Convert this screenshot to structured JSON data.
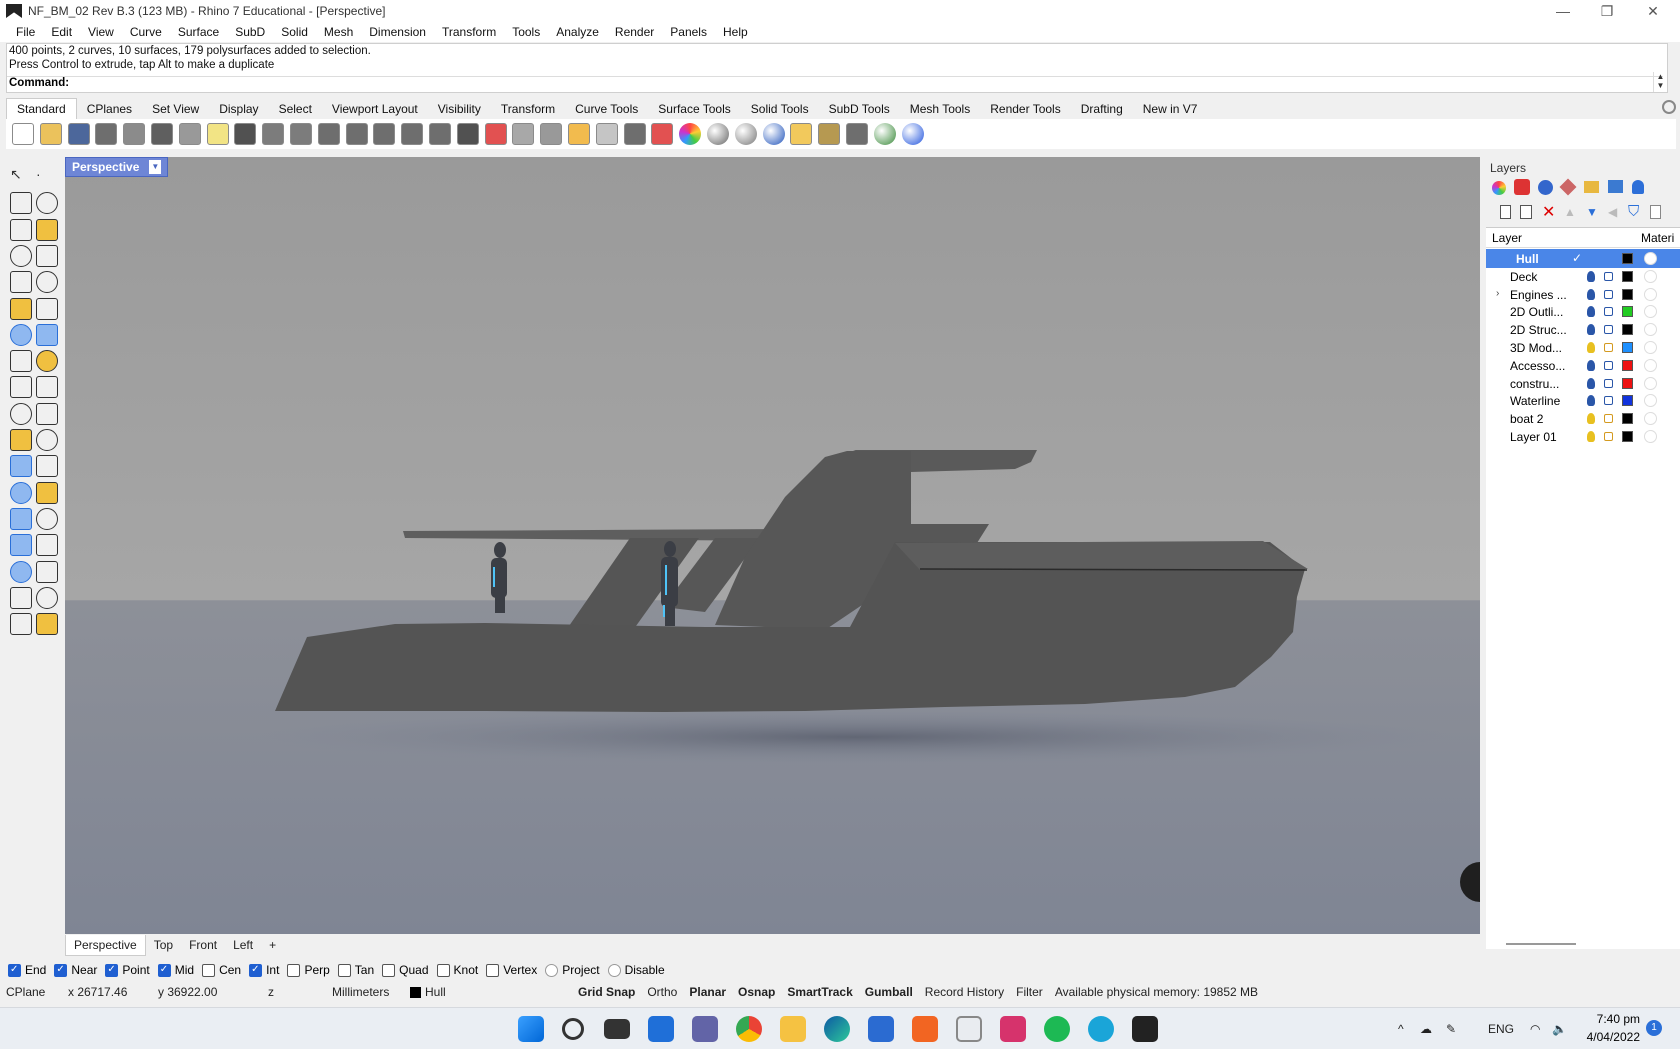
{
  "window": {
    "title": "NF_BM_02 Rev B.3 (123 MB) - Rhino 7 Educational - [Perspective]",
    "controls": [
      "—",
      "❐",
      "✕"
    ]
  },
  "menu": [
    "File",
    "Edit",
    "View",
    "Curve",
    "Surface",
    "SubD",
    "Solid",
    "Mesh",
    "Dimension",
    "Transform",
    "Tools",
    "Analyze",
    "Render",
    "Panels",
    "Help"
  ],
  "command": {
    "history": [
      "400 points, 2 curves, 10 surfaces, 179 polysurfaces added to selection.",
      "Press Control to extrude, tap Alt to make a duplicate"
    ],
    "prompt": "Command:"
  },
  "toolbar_tabs": [
    "Standard",
    "CPlanes",
    "Set View",
    "Display",
    "Select",
    "Viewport Layout",
    "Visibility",
    "Transform",
    "Curve Tools",
    "Surface Tools",
    "Solid Tools",
    "SubD Tools",
    "Mesh Tools",
    "Render Tools",
    "Drafting",
    "New in V7"
  ],
  "toolbar_icons": [
    "new-file-icon",
    "open-folder-icon",
    "save-icon",
    "print-icon",
    "export-icon",
    "cut-icon",
    "copy-icon",
    "paste-icon",
    "undo-icon",
    "pan-hand-icon",
    "rotate-view-icon",
    "zoom-icon",
    "zoom-window-icon",
    "zoom-extents-icon",
    "zoom-selected-icon",
    "rotate-icon",
    "four-views-icon",
    "car-icon",
    "motor-icon",
    "cplane-icon",
    "points-icon",
    "light-icon",
    "lock-icon",
    "layer-icon",
    "color-wheel-icon",
    "sphere-icon",
    "render-sphere-icon",
    "blue-sphere-icon",
    "filter-icon",
    "gear-icon",
    "dimension-icon",
    "globe-icon",
    "help-icon"
  ],
  "viewport": {
    "active": "Perspective",
    "tabs": [
      "Perspective",
      "Top",
      "Front",
      "Left"
    ],
    "add_tab": "+"
  },
  "layers_panel": {
    "title": "Layers",
    "col_layer": "Layer",
    "col_material": "Materi",
    "layers": [
      {
        "name": "Hull",
        "color": "#000000",
        "current": true,
        "selected": true
      },
      {
        "name": "Deck",
        "color": "#000000"
      },
      {
        "name": "Engines ...",
        "color": "#000000",
        "expandable": true
      },
      {
        "name": "2D Outli...",
        "color": "#22cc22"
      },
      {
        "name": "2D Struc...",
        "color": "#000000"
      },
      {
        "name": "3D Mod...",
        "color": "#1e90ff",
        "unlocked": true
      },
      {
        "name": "Accesso...",
        "color": "#ee1111"
      },
      {
        "name": "constru...",
        "color": "#ee1111"
      },
      {
        "name": "Waterline",
        "color": "#1133dd"
      },
      {
        "name": "boat 2",
        "color": "#000000",
        "unlocked": true
      },
      {
        "name": "Layer 01",
        "color": "#000000",
        "unlocked": true
      }
    ]
  },
  "osnaps": [
    {
      "label": "End",
      "on": true
    },
    {
      "label": "Near",
      "on": true
    },
    {
      "label": "Point",
      "on": true
    },
    {
      "label": "Mid",
      "on": true
    },
    {
      "label": "Cen",
      "on": false
    },
    {
      "label": "Int",
      "on": true
    },
    {
      "label": "Perp",
      "on": false
    },
    {
      "label": "Tan",
      "on": false
    },
    {
      "label": "Quad",
      "on": false
    },
    {
      "label": "Knot",
      "on": false
    },
    {
      "label": "Vertex",
      "on": false
    },
    {
      "label": "Project",
      "on": false,
      "round": true
    },
    {
      "label": "Disable",
      "on": false,
      "round": true
    }
  ],
  "statusbar": {
    "cplane": "CPlane",
    "x": "x 26717.46",
    "y": "y 36922.00",
    "z": "z",
    "units": "Millimeters",
    "layer": "Hull",
    "toggles": [
      {
        "label": "Grid Snap",
        "bold": true
      },
      {
        "label": "Ortho",
        "bold": false
      },
      {
        "label": "Planar",
        "bold": true
      },
      {
        "label": "Osnap",
        "bold": true
      },
      {
        "label": "SmartTrack",
        "bold": true
      },
      {
        "label": "Gumball",
        "bold": true
      },
      {
        "label": "Record History",
        "bold": false
      },
      {
        "label": "Filter",
        "bold": false
      }
    ],
    "memory": "Available physical memory: 19852 MB"
  },
  "taskbar": {
    "lang": "ENG",
    "time": "7:40 pm",
    "date": "4/04/2022",
    "notifications": "1"
  }
}
